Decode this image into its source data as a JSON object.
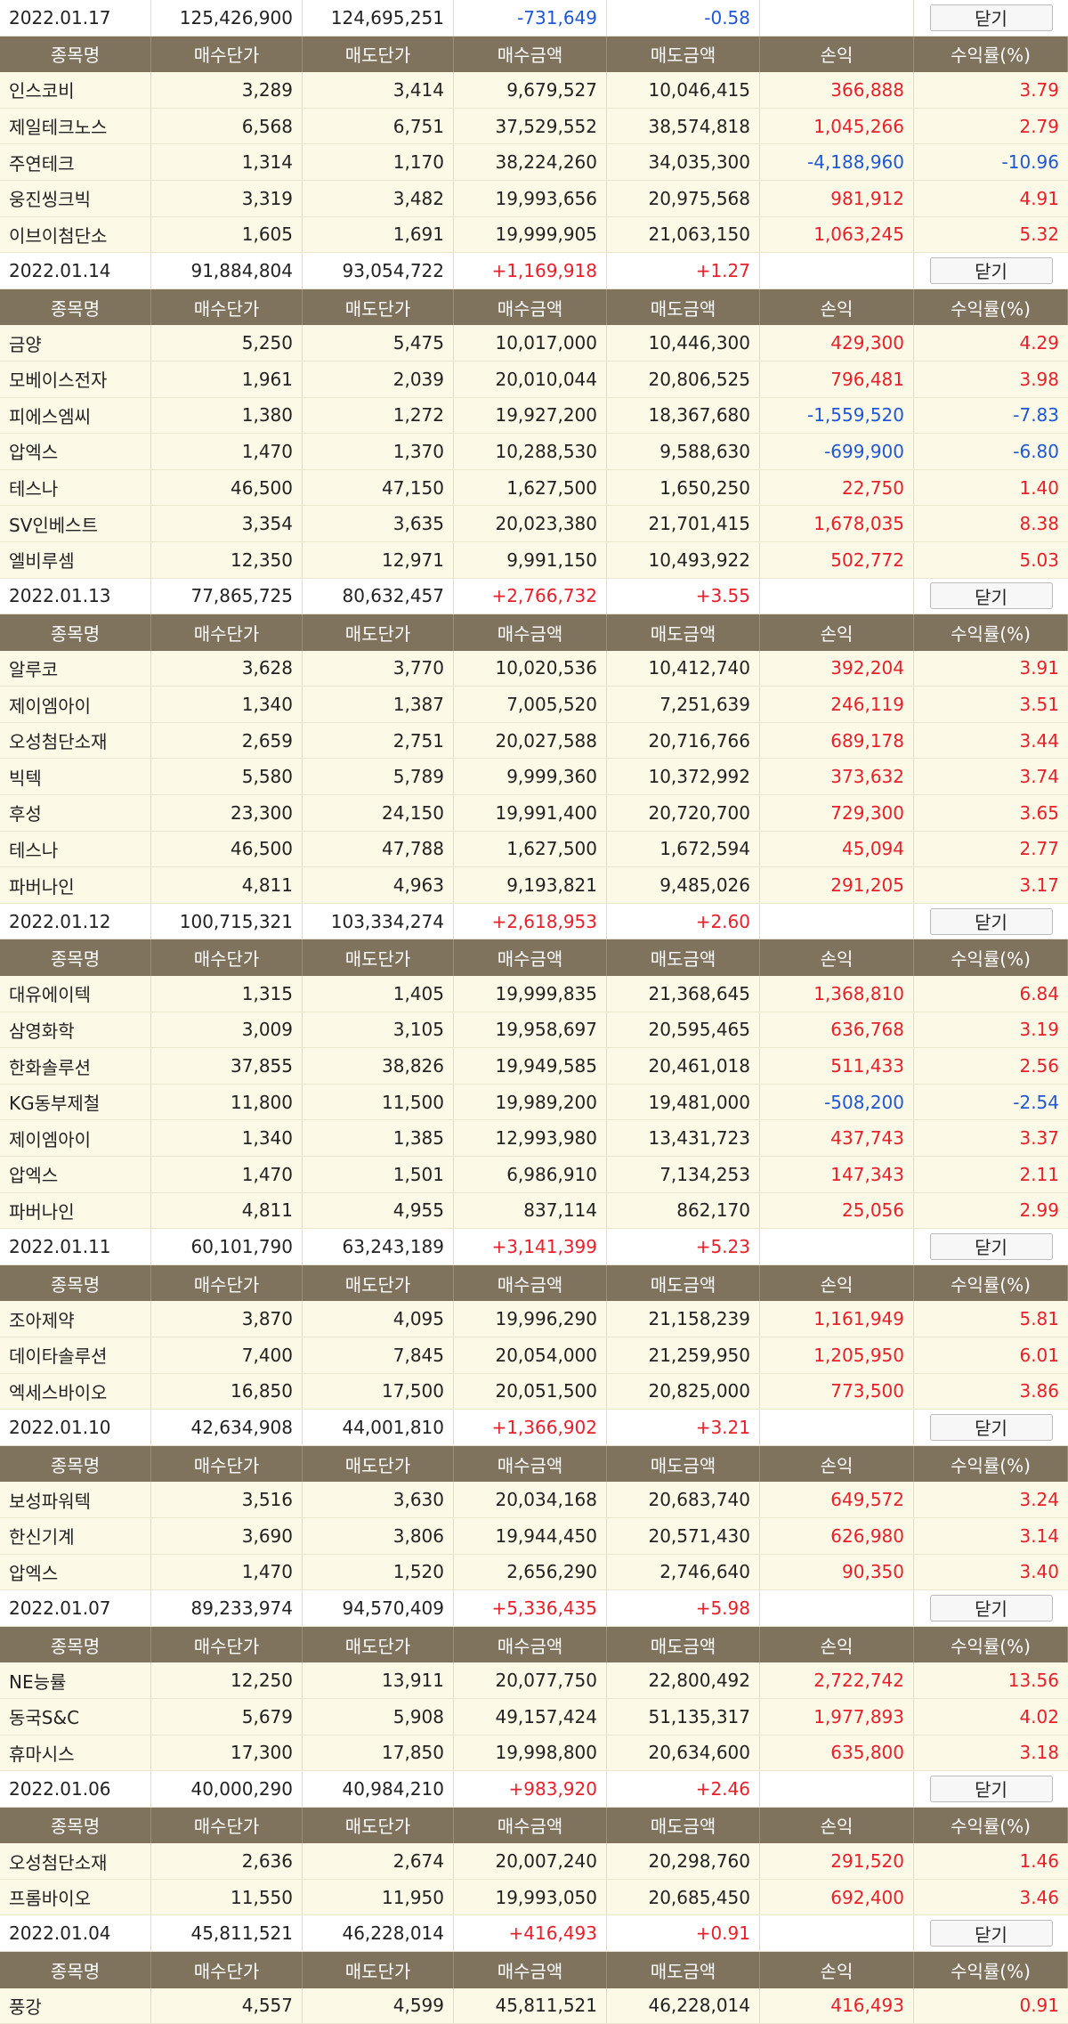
{
  "colors": {
    "header_bg": "#80735e",
    "row_bg": "#fcf9e6",
    "positive": "#e8202b",
    "negative": "#1f57d6"
  },
  "columns": [
    "종목명",
    "매수단가",
    "매도단가",
    "매수금액",
    "매도금액",
    "손익",
    "수익률(%)"
  ],
  "close_label": "닫기",
  "sections": [
    {
      "date": "2022.01.17",
      "buy_total": "125,426,900",
      "sell_total": "124,695,251",
      "pnl": "-731,649",
      "rate": "-0.58",
      "rows": [
        [
          "인스코비",
          "3,289",
          "3,414",
          "9,679,527",
          "10,046,415",
          "366,888",
          "3.79"
        ],
        [
          "제일테크노스",
          "6,568",
          "6,751",
          "37,529,552",
          "38,574,818",
          "1,045,266",
          "2.79"
        ],
        [
          "주연테크",
          "1,314",
          "1,170",
          "38,224,260",
          "34,035,300",
          "-4,188,960",
          "-10.96"
        ],
        [
          "웅진씽크빅",
          "3,319",
          "3,482",
          "19,993,656",
          "20,975,568",
          "981,912",
          "4.91"
        ],
        [
          "이브이첨단소",
          "1,605",
          "1,691",
          "19,999,905",
          "21,063,150",
          "1,063,245",
          "5.32"
        ]
      ]
    },
    {
      "date": "2022.01.14",
      "buy_total": "91,884,804",
      "sell_total": "93,054,722",
      "pnl": "+1,169,918",
      "rate": "+1.27",
      "rows": [
        [
          "금양",
          "5,250",
          "5,475",
          "10,017,000",
          "10,446,300",
          "429,300",
          "4.29"
        ],
        [
          "모베이스전자",
          "1,961",
          "2,039",
          "20,010,044",
          "20,806,525",
          "796,481",
          "3.98"
        ],
        [
          "피에스엠씨",
          "1,380",
          "1,272",
          "19,927,200",
          "18,367,680",
          "-1,559,520",
          "-7.83"
        ],
        [
          "압엑스",
          "1,470",
          "1,370",
          "10,288,530",
          "9,588,630",
          "-699,900",
          "-6.80"
        ],
        [
          "테스나",
          "46,500",
          "47,150",
          "1,627,500",
          "1,650,250",
          "22,750",
          "1.40"
        ],
        [
          "SV인베스트",
          "3,354",
          "3,635",
          "20,023,380",
          "21,701,415",
          "1,678,035",
          "8.38"
        ],
        [
          "엘비루셈",
          "12,350",
          "12,971",
          "9,991,150",
          "10,493,922",
          "502,772",
          "5.03"
        ]
      ]
    },
    {
      "date": "2022.01.13",
      "buy_total": "77,865,725",
      "sell_total": "80,632,457",
      "pnl": "+2,766,732",
      "rate": "+3.55",
      "rows": [
        [
          "알루코",
          "3,628",
          "3,770",
          "10,020,536",
          "10,412,740",
          "392,204",
          "3.91"
        ],
        [
          "제이엠아이",
          "1,340",
          "1,387",
          "7,005,520",
          "7,251,639",
          "246,119",
          "3.51"
        ],
        [
          "오성첨단소재",
          "2,659",
          "2,751",
          "20,027,588",
          "20,716,766",
          "689,178",
          "3.44"
        ],
        [
          "빅텍",
          "5,580",
          "5,789",
          "9,999,360",
          "10,372,992",
          "373,632",
          "3.74"
        ],
        [
          "후성",
          "23,300",
          "24,150",
          "19,991,400",
          "20,720,700",
          "729,300",
          "3.65"
        ],
        [
          "테스나",
          "46,500",
          "47,788",
          "1,627,500",
          "1,672,594",
          "45,094",
          "2.77"
        ],
        [
          "파버나인",
          "4,811",
          "4,963",
          "9,193,821",
          "9,485,026",
          "291,205",
          "3.17"
        ]
      ]
    },
    {
      "date": "2022.01.12",
      "buy_total": "100,715,321",
      "sell_total": "103,334,274",
      "pnl": "+2,618,953",
      "rate": "+2.60",
      "rows": [
        [
          "대유에이텍",
          "1,315",
          "1,405",
          "19,999,835",
          "21,368,645",
          "1,368,810",
          "6.84"
        ],
        [
          "삼영화학",
          "3,009",
          "3,105",
          "19,958,697",
          "20,595,465",
          "636,768",
          "3.19"
        ],
        [
          "한화솔루션",
          "37,855",
          "38,826",
          "19,949,585",
          "20,461,018",
          "511,433",
          "2.56"
        ],
        [
          "KG동부제철",
          "11,800",
          "11,500",
          "19,989,200",
          "19,481,000",
          "-508,200",
          "-2.54"
        ],
        [
          "제이엠아이",
          "1,340",
          "1,385",
          "12,993,980",
          "13,431,723",
          "437,743",
          "3.37"
        ],
        [
          "압엑스",
          "1,470",
          "1,501",
          "6,986,910",
          "7,134,253",
          "147,343",
          "2.11"
        ],
        [
          "파버나인",
          "4,811",
          "4,955",
          "837,114",
          "862,170",
          "25,056",
          "2.99"
        ]
      ]
    },
    {
      "date": "2022.01.11",
      "buy_total": "60,101,790",
      "sell_total": "63,243,189",
      "pnl": "+3,141,399",
      "rate": "+5.23",
      "rows": [
        [
          "조아제약",
          "3,870",
          "4,095",
          "19,996,290",
          "21,158,239",
          "1,161,949",
          "5.81"
        ],
        [
          "데이타솔루션",
          "7,400",
          "7,845",
          "20,054,000",
          "21,259,950",
          "1,205,950",
          "6.01"
        ],
        [
          "엑세스바이오",
          "16,850",
          "17,500",
          "20,051,500",
          "20,825,000",
          "773,500",
          "3.86"
        ]
      ]
    },
    {
      "date": "2022.01.10",
      "buy_total": "42,634,908",
      "sell_total": "44,001,810",
      "pnl": "+1,366,902",
      "rate": "+3.21",
      "rows": [
        [
          "보성파워텍",
          "3,516",
          "3,630",
          "20,034,168",
          "20,683,740",
          "649,572",
          "3.24"
        ],
        [
          "한신기계",
          "3,690",
          "3,806",
          "19,944,450",
          "20,571,430",
          "626,980",
          "3.14"
        ],
        [
          "압엑스",
          "1,470",
          "1,520",
          "2,656,290",
          "2,746,640",
          "90,350",
          "3.40"
        ]
      ]
    },
    {
      "date": "2022.01.07",
      "buy_total": "89,233,974",
      "sell_total": "94,570,409",
      "pnl": "+5,336,435",
      "rate": "+5.98",
      "rows": [
        [
          "NE능률",
          "12,250",
          "13,911",
          "20,077,750",
          "22,800,492",
          "2,722,742",
          "13.56"
        ],
        [
          "동국S&C",
          "5,679",
          "5,908",
          "49,157,424",
          "51,135,317",
          "1,977,893",
          "4.02"
        ],
        [
          "휴마시스",
          "17,300",
          "17,850",
          "19,998,800",
          "20,634,600",
          "635,800",
          "3.18"
        ]
      ]
    },
    {
      "date": "2022.01.06",
      "buy_total": "40,000,290",
      "sell_total": "40,984,210",
      "pnl": "+983,920",
      "rate": "+2.46",
      "rows": [
        [
          "오성첨단소재",
          "2,636",
          "2,674",
          "20,007,240",
          "20,298,760",
          "291,520",
          "1.46"
        ],
        [
          "프롬바이오",
          "11,550",
          "11,950",
          "19,993,050",
          "20,685,450",
          "692,400",
          "3.46"
        ]
      ]
    },
    {
      "date": "2022.01.04",
      "buy_total": "45,811,521",
      "sell_total": "46,228,014",
      "pnl": "+416,493",
      "rate": "+0.91",
      "rows": [
        [
          "풍강",
          "4,557",
          "4,599",
          "45,811,521",
          "46,228,014",
          "416,493",
          "0.91"
        ]
      ]
    }
  ]
}
